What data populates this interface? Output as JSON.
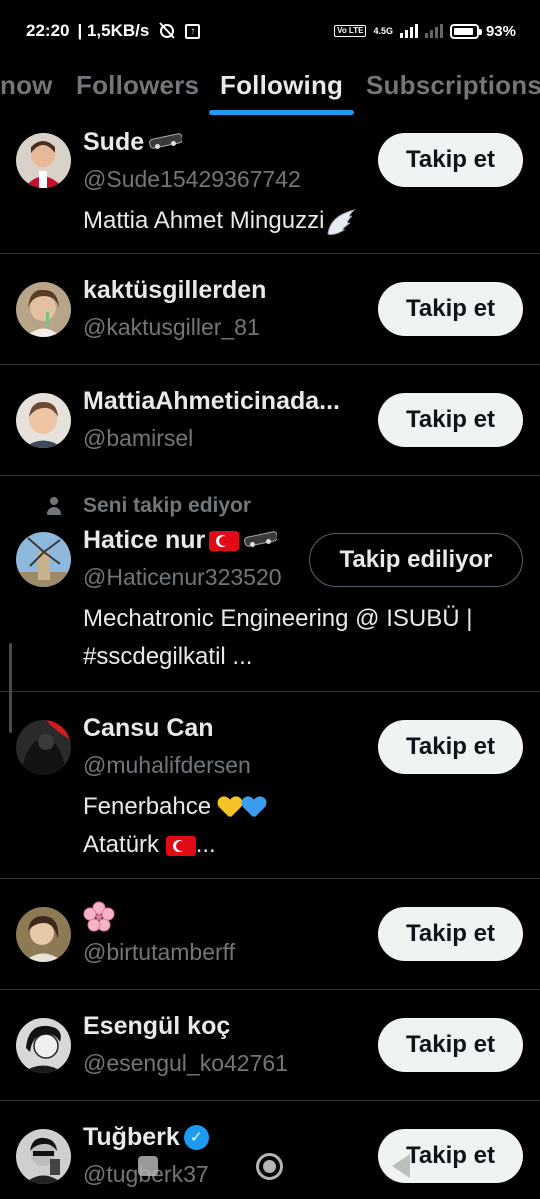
{
  "status_bar": {
    "time": "22:20",
    "network_speed": "| 1,5KB/s",
    "network_type": "4.5G",
    "battery": "93%",
    "battery_level": 0.93
  },
  "tabs": [
    {
      "label": "now"
    },
    {
      "label": "Followers"
    },
    {
      "label": "Following"
    },
    {
      "label": "Subscriptions"
    }
  ],
  "active_tab": "Following",
  "labels": {
    "follow": "Takip et",
    "following": "Takip ediliyor",
    "follows_you": "Seni takip ediyor"
  },
  "users": [
    {
      "name": "Sude",
      "handle": "@Sude15429367742",
      "bio": "Mattia Ahmet Minguzzi"
    },
    {
      "name": "kaktüsgillerden",
      "handle": "@kaktusgiller_81",
      "bio": ""
    },
    {
      "name": "MattiaAhmeticinada...",
      "handle": "@bamirsel",
      "bio": ""
    },
    {
      "name": "Hatice nur",
      "handle": "@Haticenur323520",
      "bio_line1": "Mechatronic Engineering @ ISUBÜ |",
      "bio_line2": "#sscdegilkatil ..."
    },
    {
      "name": "Cansu Can",
      "handle": "@muhalifdersen",
      "bio_line1": "Fenerbahce",
      "bio_line2": "Atatürk",
      "bio_line2_suffix": "..."
    },
    {
      "name": "",
      "handle": "@birtutamberff",
      "bio": ""
    },
    {
      "name": "Esengül koç",
      "handle": "@esengul_ko42761",
      "bio": ""
    },
    {
      "name": "Tuğberk",
      "handle": "@tugberk37",
      "bio": ""
    }
  ],
  "icons": {
    "verified": "✓"
  },
  "colors": {
    "background": "#000000",
    "accent": "#1d9bf0",
    "secondary_text": "#71767b",
    "button_bg": "#eff3f4"
  }
}
